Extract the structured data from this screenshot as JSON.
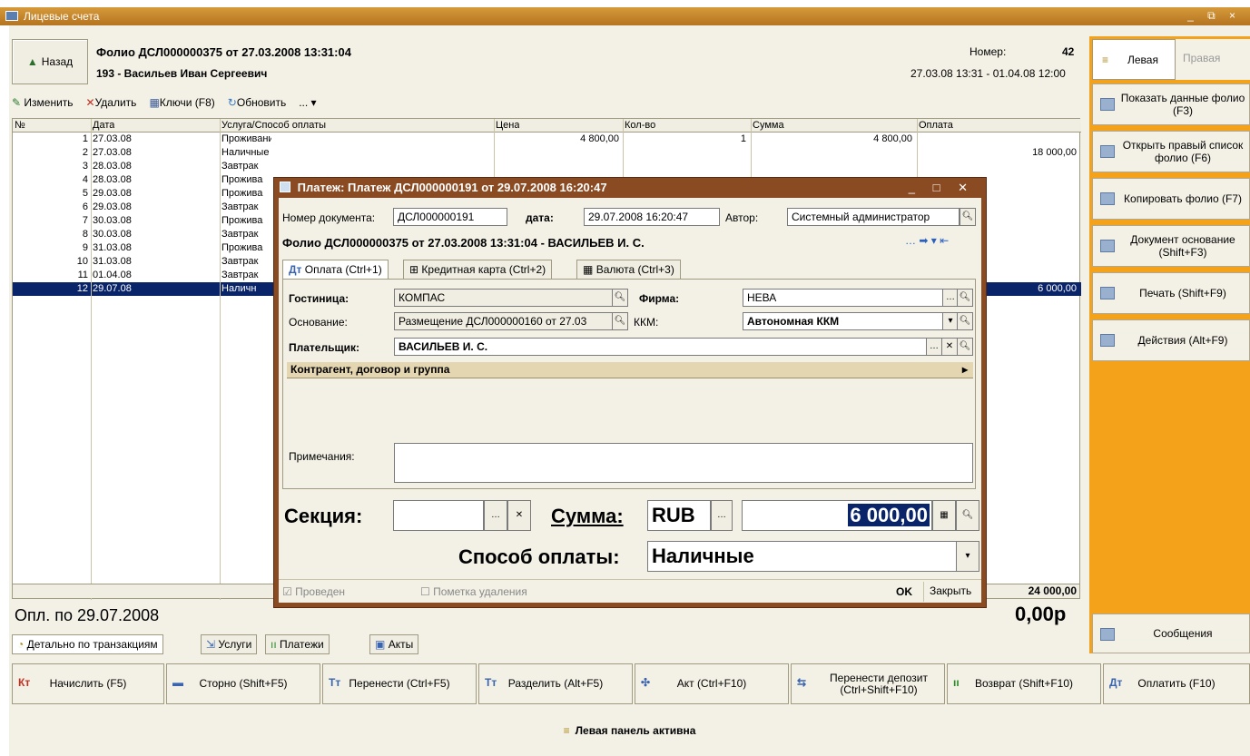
{
  "window": {
    "title": "Лицевые счета",
    "controls": "_ ⧉ ×"
  },
  "header": {
    "back": "Назад",
    "folio": "Фолио ДСЛ000000375 от 27.03.2008 13:31:04",
    "guest": "193 - Васильев Иван Сергеевич",
    "number_label": "Номер:",
    "number": "42",
    "period": "27.03.08 13:31 - 01.04.08 12:00"
  },
  "toolbar": {
    "edit": "Изменить",
    "delete": "Удалить",
    "keys": "Ключи (F8)",
    "refresh": "Обновить",
    "more": "... ▾"
  },
  "columns": [
    "№",
    "Дата",
    "Услуга/Способ оплаты",
    "Цена",
    "Кол-во",
    "Сумма",
    "Оплата"
  ],
  "rows": [
    {
      "n": "1",
      "date": "27.03.08",
      "svc": "Проживание",
      "price": "4 800,00",
      "qty": "1",
      "sum": "4 800,00",
      "pay": ""
    },
    {
      "n": "2",
      "date": "27.03.08",
      "svc": "Наличные",
      "price": "",
      "qty": "",
      "sum": "",
      "pay": "18 000,00"
    },
    {
      "n": "3",
      "date": "28.03.08",
      "svc": "Завтрак",
      "price": "",
      "qty": "",
      "sum": "",
      "pay": ""
    },
    {
      "n": "4",
      "date": "28.03.08",
      "svc": "Прожива",
      "price": "",
      "qty": "",
      "sum": "",
      "pay": ""
    },
    {
      "n": "5",
      "date": "29.03.08",
      "svc": "Прожива",
      "price": "",
      "qty": "",
      "sum": "",
      "pay": ""
    },
    {
      "n": "6",
      "date": "29.03.08",
      "svc": "Завтрак",
      "price": "",
      "qty": "",
      "sum": "",
      "pay": ""
    },
    {
      "n": "7",
      "date": "30.03.08",
      "svc": "Прожива",
      "price": "",
      "qty": "",
      "sum": "",
      "pay": ""
    },
    {
      "n": "8",
      "date": "30.03.08",
      "svc": "Завтрак",
      "price": "",
      "qty": "",
      "sum": "",
      "pay": ""
    },
    {
      "n": "9",
      "date": "31.03.08",
      "svc": "Прожива",
      "price": "",
      "qty": "",
      "sum": "",
      "pay": ""
    },
    {
      "n": "10",
      "date": "31.03.08",
      "svc": "Завтрак",
      "price": "",
      "qty": "",
      "sum": "",
      "pay": ""
    },
    {
      "n": "11",
      "date": "01.04.08",
      "svc": "Завтрак",
      "price": "",
      "qty": "",
      "sum": "",
      "pay": ""
    },
    {
      "n": "12",
      "date": "29.07.08",
      "svc": "Наличн",
      "price": "",
      "qty": "",
      "sum": "",
      "pay": "6 000,00"
    }
  ],
  "totals": {
    "pay_total": "24 000,00",
    "paid_to": "Опл. по 29.07.2008",
    "balance": "0,00р"
  },
  "bottom_tabs": [
    "Детально по транзакциям",
    "Услуги",
    "Платежи",
    "Акты"
  ],
  "right_panel": {
    "left_tab": "Левая",
    "right_tab": "Правая",
    "buttons": [
      "Показать данные фолио (F3)",
      "Открыть правый список фолио (F6)",
      "Копировать фолио (F7)",
      "Документ основание (Shift+F3)",
      "Печать (Shift+F9)",
      "Действия (Alt+F9)"
    ],
    "messages": "Сообщения"
  },
  "actions": [
    {
      "icon": "Кт",
      "label": "Начислить (F5)"
    },
    {
      "icon": "▬",
      "label": "Сторно (Shift+F5)"
    },
    {
      "icon": "Тт",
      "label": "Перенести (Ctrl+F5)"
    },
    {
      "icon": "Тт",
      "label": "Разделить (Alt+F5)"
    },
    {
      "icon": "✣",
      "label": "Акт (Ctrl+F10)"
    },
    {
      "icon": "⇆",
      "label": "Перенести депозит (Ctrl+Shift+F10)"
    },
    {
      "icon": "ıı",
      "label": "Возврат (Shift+F10)"
    },
    {
      "icon": "Дт",
      "label": "Оплатить (F10)"
    }
  ],
  "status": "Левая панель активна",
  "dialog": {
    "title": "Платеж: Платеж ДСЛ000000191 от 29.07.2008 16:20:47",
    "doc_label": "Номер документа:",
    "doc": "ДСЛ000000191",
    "date_label": "дата:",
    "date": "29.07.2008 16:20:47",
    "author_label": "Автор:",
    "author": "Системный администратор",
    "folio": "Фолио ДСЛ000000375 от 27.03.2008 13:31:04 - ВАСИЛЬЕВ И. С.",
    "tabs": [
      "Оплата (Ctrl+1)",
      "Кредитная карта (Ctrl+2)",
      "Валюта (Ctrl+3)"
    ],
    "hotel_label": "Гостиница:",
    "hotel": "КОМПАС",
    "firm_label": "Фирма:",
    "firm": "НЕВА",
    "basis_label": "Основание:",
    "basis": "Размещение ДСЛ000000160 от 27.03",
    "kkm_label": "ККМ:",
    "kkm": "Автономная ККМ",
    "payer_label": "Плательщик:",
    "payer": "ВАСИЛЬЕВ И. С.",
    "contractor": "Контрагент, договор и группа",
    "notes_label": "Примечания:",
    "section_label": "Секция:",
    "sum_label": "Сумма:",
    "currency": "RUB",
    "amount": "6 000,00",
    "method_label": "Способ оплаты:",
    "method": "Наличные",
    "posted": "Проведен",
    "deleted": "Пометка удаления",
    "ok": "OK",
    "close": "Закрыть"
  }
}
